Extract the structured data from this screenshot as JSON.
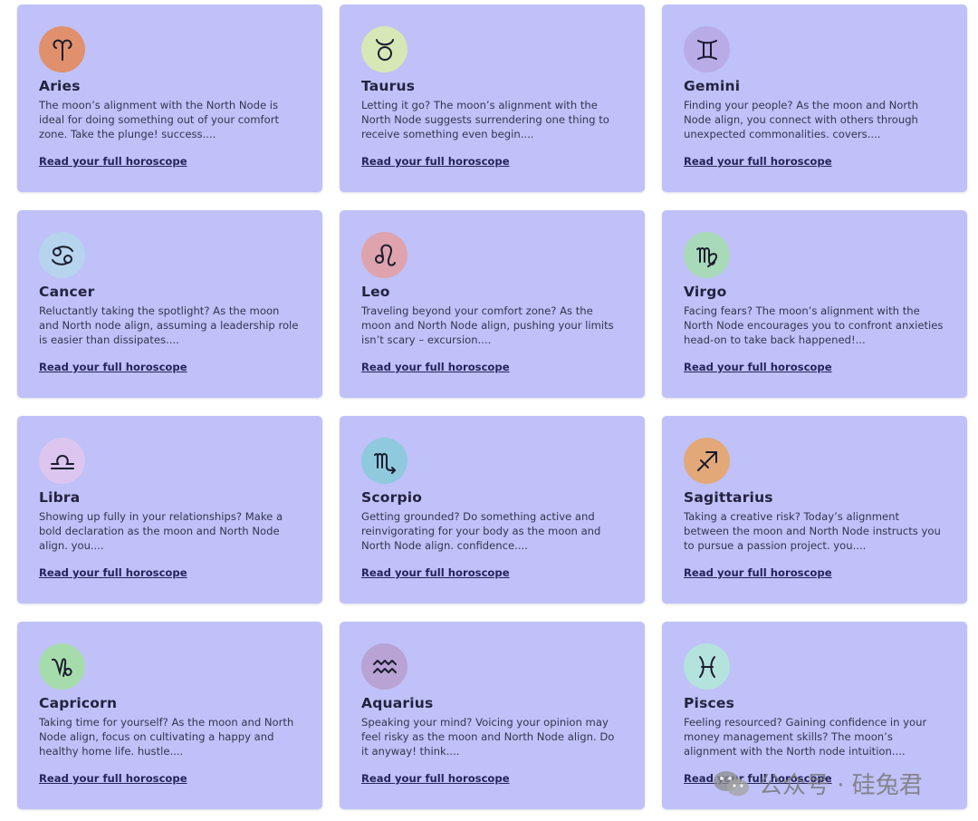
{
  "link_label": "Read your full horoscope",
  "signs": [
    {
      "name": "Aries",
      "icon": "aries-icon",
      "color": "#e0906c",
      "desc": "The moon’s alignment with the North Node is ideal for doing something out of your comfort zone. Take the plunge! success...."
    },
    {
      "name": "Taurus",
      "icon": "taurus-icon",
      "color": "#d5e8b6",
      "desc": "Letting it go? The moon’s alignment with the North Node suggests surrendering one thing to receive something even begin...."
    },
    {
      "name": "Gemini",
      "icon": "gemini-icon",
      "color": "#b8abe6",
      "desc": "Finding your people? As the moon and North Node align, you connect with others through unexpected commonalities. covers...."
    },
    {
      "name": "Cancer",
      "icon": "cancer-icon",
      "color": "#b6d4ee",
      "desc": "Reluctantly taking the spotlight? As the moon and North node align, assuming a leadership role is easier than dissipates...."
    },
    {
      "name": "Leo",
      "icon": "leo-icon",
      "color": "#dea3ad",
      "desc": "Traveling beyond your comfort zone? As the moon and North Node align, pushing your limits isn’t scary – excursion...."
    },
    {
      "name": "Virgo",
      "icon": "virgo-icon",
      "color": "#a8d9b8",
      "desc": "Facing fears? The moon’s alignment with the North Node encourages you to confront anxieties head-on to take back happened!..."
    },
    {
      "name": "Libra",
      "icon": "libra-icon",
      "color": "#dcc5ee",
      "desc": "Showing up fully in your relationships? Make a bold declaration as the moon and North Node align. you...."
    },
    {
      "name": "Scorpio",
      "icon": "scorpio-icon",
      "color": "#8fc9de",
      "desc": "Getting grounded? Do something active and reinvigorating for your body as the moon and North Node align. confidence...."
    },
    {
      "name": "Sagittarius",
      "icon": "sagittarius-icon",
      "color": "#e3a878",
      "desc": "Taking a creative risk? Today’s alignment between the moon and North Node instructs you to pursue a passion project. you...."
    },
    {
      "name": "Capricorn",
      "icon": "capricorn-icon",
      "color": "#a6dcac",
      "desc": "Taking time for yourself? As the moon and North Node align, focus on cultivating a happy and healthy home life. hustle...."
    },
    {
      "name": "Aquarius",
      "icon": "aquarius-icon",
      "color": "#b8a3d4",
      "desc": "Speaking your mind? Voicing your opinion may feel risky as the moon and North Node align. Do it anyway! think...."
    },
    {
      "name": "Pisces",
      "icon": "pisces-icon",
      "color": "#b3e3dc",
      "desc": "Feeling resourced? Gaining confidence in your money management skills? The moon’s alignment with the North node intuition...."
    }
  ],
  "watermark": {
    "text": "公众号 · 硅兔君"
  }
}
